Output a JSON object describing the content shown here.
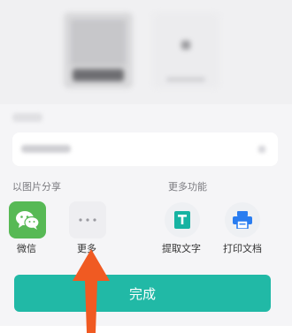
{
  "sections": {
    "share_title": "以图片分享",
    "more_title": "更多功能"
  },
  "share_items": [
    {
      "label": "微信",
      "icon": "wechat-icon"
    },
    {
      "label": "更多",
      "icon": "more-icon"
    }
  ],
  "more_items": [
    {
      "label": "提取文字",
      "icon": "text-extract-icon"
    },
    {
      "label": "打印文档",
      "icon": "printer-icon"
    }
  ],
  "done_button": "完成",
  "colors": {
    "accent": "#21b9a6",
    "wechat": "#57b955",
    "arrow": "#f05a22",
    "icon_blue": "#2a7df0",
    "icon_teal": "#17b3a2"
  }
}
